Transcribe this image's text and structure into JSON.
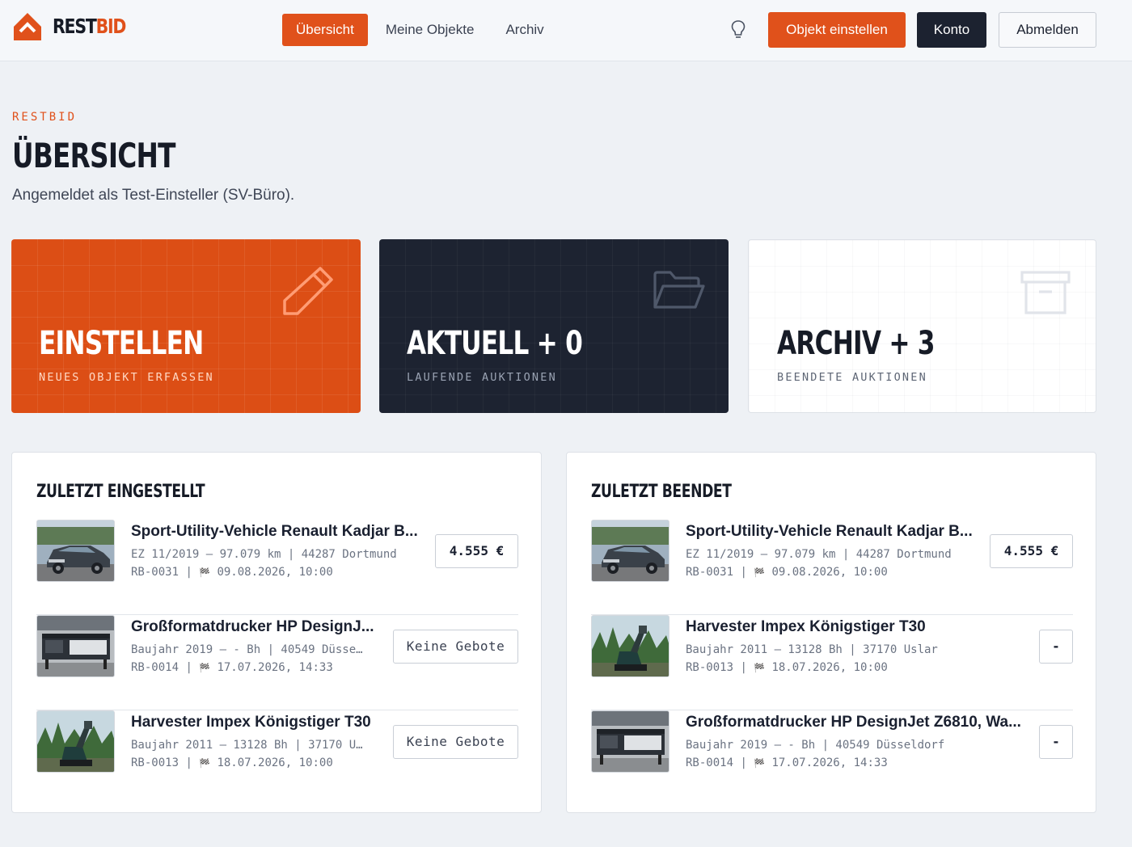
{
  "brand": {
    "part1": "REST",
    "part2": "BID",
    "accent": "#e0511b",
    "dark": "#1c2230"
  },
  "nav": {
    "items": [
      "Übersicht",
      "Meine Objekte",
      "Archiv"
    ],
    "active": "Übersicht"
  },
  "header": {
    "create_button": "Objekt einstellen",
    "account_button": "Konto",
    "logout_button": "Abmelden",
    "theme_icon": "lightbulb-icon"
  },
  "page": {
    "eyebrow": "RESTBID",
    "title": "ÜBERSICHT",
    "subtitle": "Angemeldet als Test-Einsteller (SV-Büro)."
  },
  "tiles": [
    {
      "title": "EINSTELLEN",
      "subtitle": "NEUES OBJEKT ERFASSEN",
      "icon": "pencil-icon"
    },
    {
      "title": "AKTUELL + 0",
      "subtitle": "LAUFENDE AUKTIONEN",
      "icon": "folder-icon"
    },
    {
      "title": "ARCHIV + 3",
      "subtitle": "BEENDETE AUKTIONEN",
      "icon": "archive-box-icon"
    }
  ],
  "recent_created": {
    "title": "ZULETZT EINGESTELLT",
    "items": [
      {
        "title": "Sport-Utility-Vehicle Renault Kadjar B...",
        "meta": "EZ 11/2019 – 97.079 km | 44287 Dortmund",
        "id": "RB-0031",
        "sep": " | ",
        "flag": "🏁",
        "end": "09.08.2026, 10:00",
        "badge": "4.555 €",
        "image": "car"
      },
      {
        "title": "Großformatdrucker HP DesignJ...",
        "meta": "Baujahr 2019 – - Bh | 40549 Düsse…",
        "id": "RB-0014",
        "sep": " | ",
        "flag": "🏁",
        "end": "17.07.2026, 14:33",
        "badge": "Keine Gebote",
        "image": "printer"
      },
      {
        "title": "Harvester Impex Königstiger T30",
        "meta": "Baujahr 2011 – 13128 Bh | 37170 U…",
        "id": "RB-0013",
        "sep": " | ",
        "flag": "🏁",
        "end": "18.07.2026, 10:00",
        "badge": "Keine Gebote",
        "image": "harvester"
      }
    ]
  },
  "recent_finished": {
    "title": "ZULETZT BEENDET",
    "items": [
      {
        "title": "Sport-Utility-Vehicle Renault Kadjar B...",
        "meta": "EZ 11/2019 – 97.079 km | 44287 Dortmund",
        "id": "RB-0031",
        "sep": " | ",
        "flag": "🏁",
        "end": "09.08.2026, 10:00",
        "badge": "4.555 €",
        "image": "car"
      },
      {
        "title": "Harvester Impex Königstiger T30",
        "meta": "Baujahr 2011 – 13128 Bh | 37170 Uslar",
        "id": "RB-0013",
        "sep": " | ",
        "flag": "🏁",
        "end": "18.07.2026, 10:00",
        "badge": "-",
        "image": "harvester"
      },
      {
        "title": "Großformatdrucker HP DesignJet Z6810, Wa...",
        "meta": "Baujahr 2019 – - Bh | 40549 Düsseldorf",
        "id": "RB-0014",
        "sep": " | ",
        "flag": "🏁",
        "end": "17.07.2026, 14:33",
        "badge": "-",
        "image": "printer"
      }
    ]
  }
}
